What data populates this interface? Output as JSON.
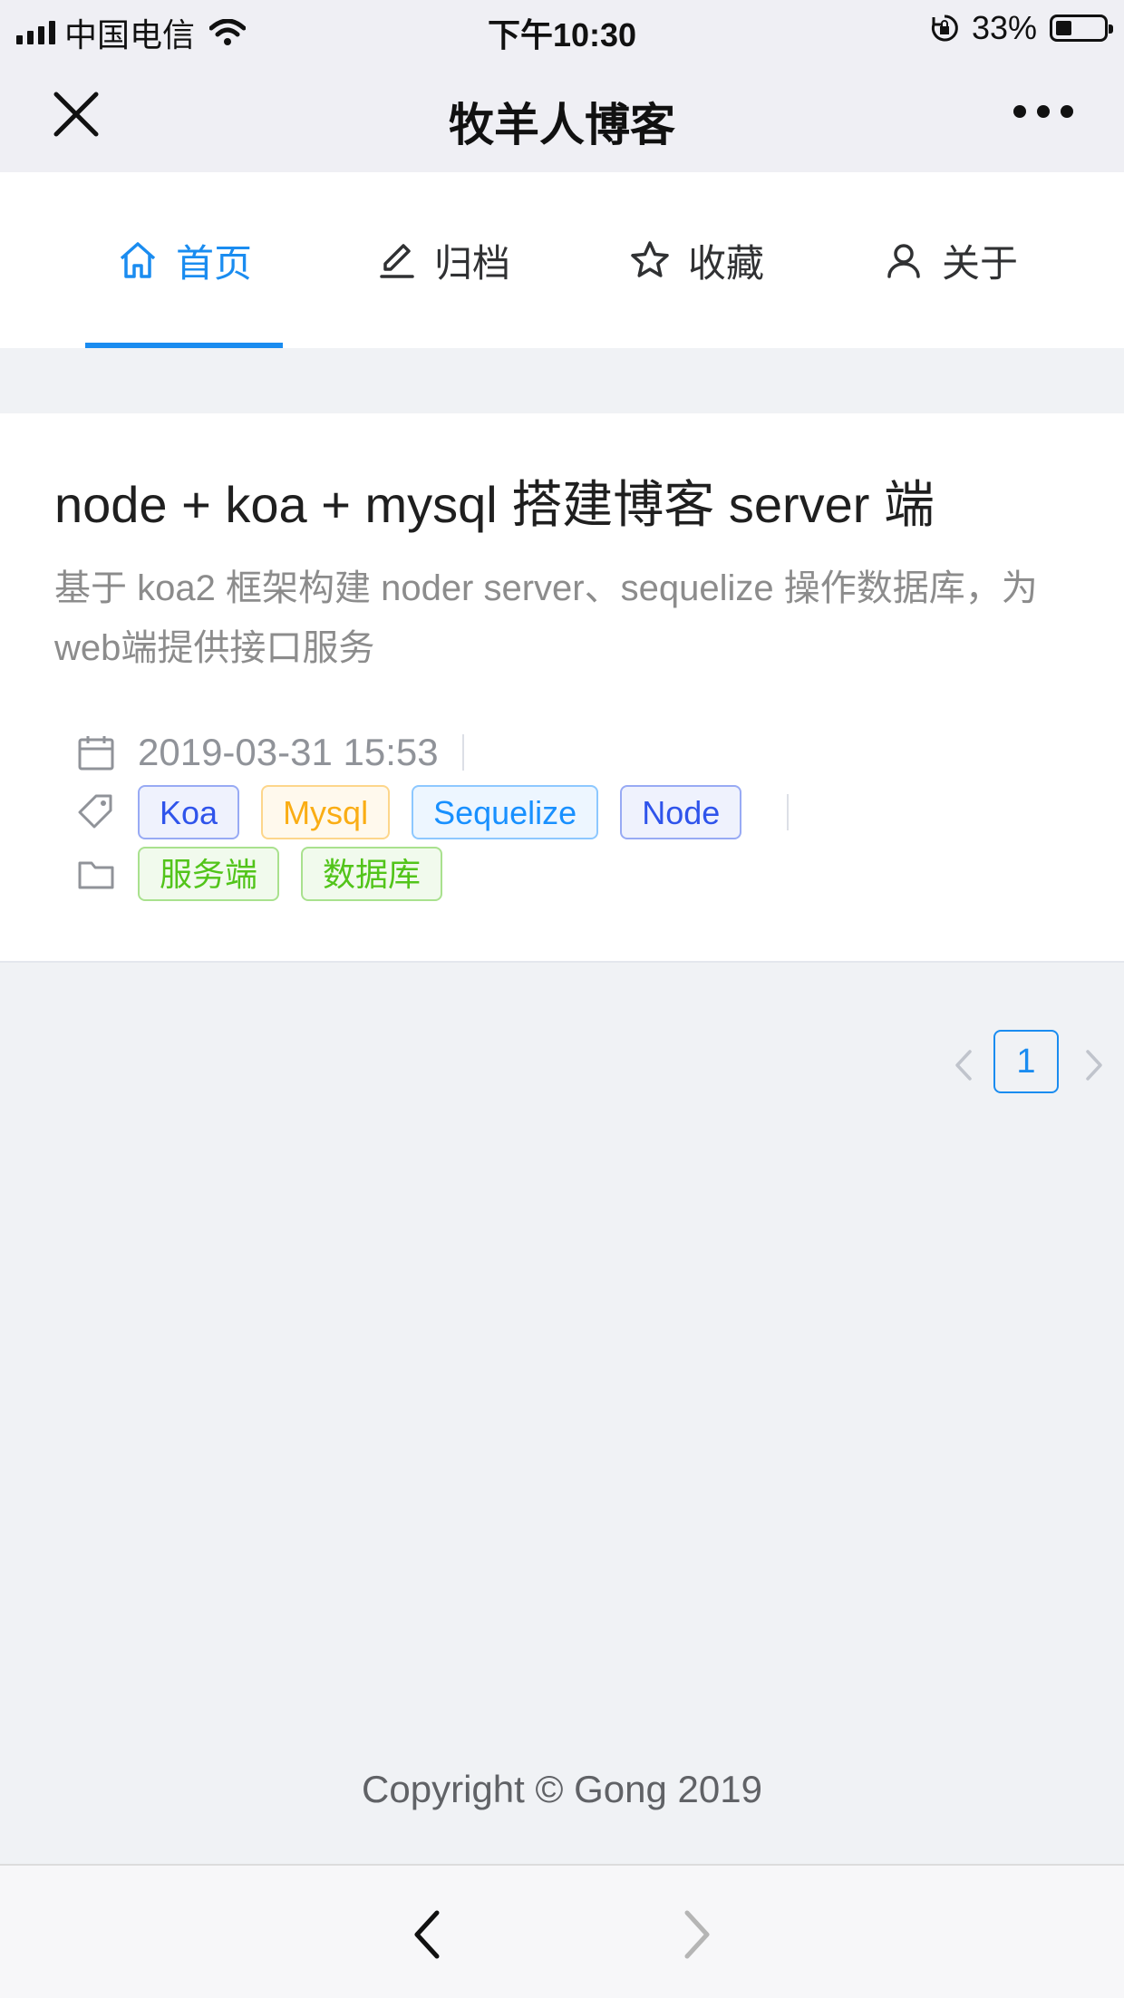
{
  "status_bar": {
    "carrier": "中国电信",
    "time": "下午10:30",
    "battery": "33%",
    "battery_level": 0.33,
    "icons": [
      "signal-icon",
      "wifi-icon",
      "orientation-lock-icon",
      "battery-icon"
    ]
  },
  "nav": {
    "title": "牧羊人博客",
    "icons": [
      "close-icon",
      "more-icon"
    ]
  },
  "menu": {
    "active_color": "#1a8cf0",
    "items": [
      {
        "label": "首页",
        "icon": "home-icon",
        "active": true
      },
      {
        "label": "归档",
        "icon": "edit-icon",
        "active": false
      },
      {
        "label": "收藏",
        "icon": "star-icon",
        "active": false
      },
      {
        "label": "关于",
        "icon": "user-icon",
        "active": false
      }
    ]
  },
  "article": {
    "title": "node + koa + mysql 搭建博客 server 端",
    "description": "基于 koa2 框架构建 noder server、sequelize 操作数据库，为web端提供接口服务",
    "date": "2019-03-31 15:53",
    "tags": [
      {
        "label": "Koa",
        "color": "#2f54eb"
      },
      {
        "label": "Mysql",
        "color": "#faad14"
      },
      {
        "label": "Sequelize",
        "color": "#1890ff"
      },
      {
        "label": "Node",
        "color": "#2f54eb"
      }
    ],
    "categories": [
      {
        "label": "服务端",
        "color": "#52c41a"
      },
      {
        "label": "数据库",
        "color": "#52c41a"
      }
    ]
  },
  "pagination": {
    "current_page": "1"
  },
  "footer": {
    "copyright": "Copyright © Gong 2019"
  }
}
